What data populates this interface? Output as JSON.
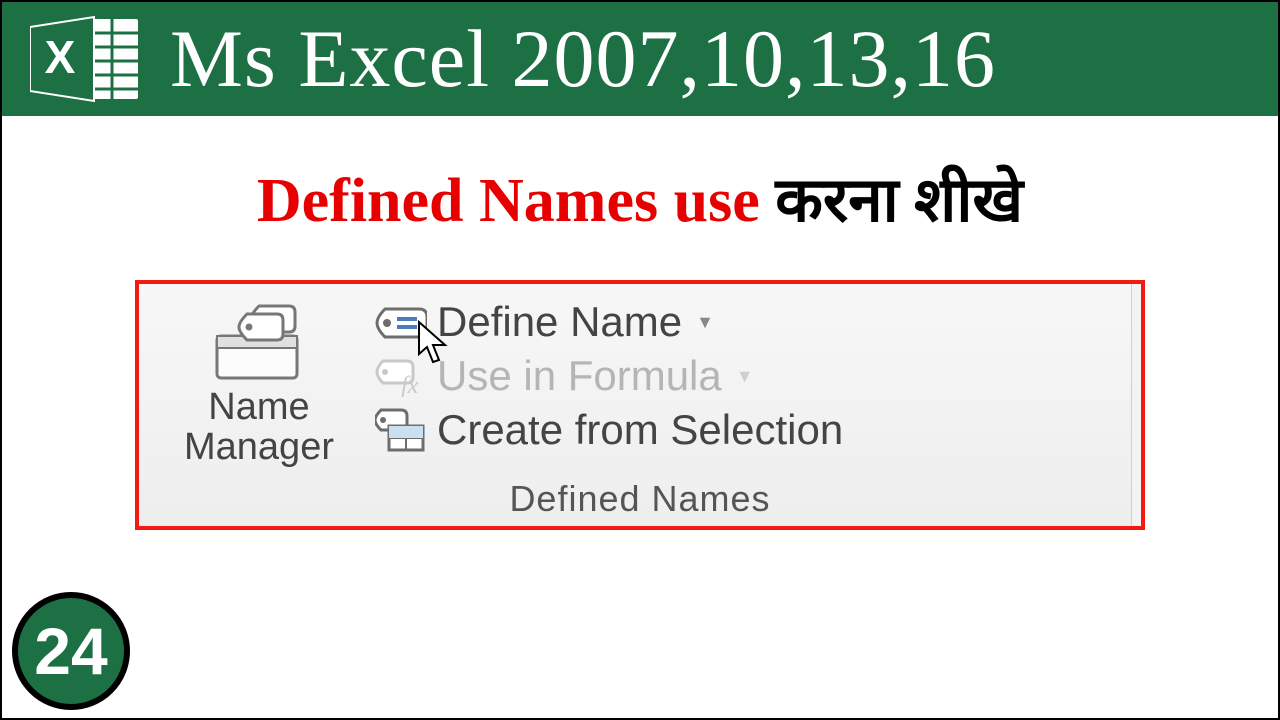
{
  "banner": {
    "title": "Ms Excel 2007,10,13,16"
  },
  "subtitle": {
    "part1": "Defined Names use ",
    "part2": "करना शीखे"
  },
  "ribbon": {
    "name_manager": {
      "line1": "Name",
      "line2": "Manager"
    },
    "define_name": "Define Name",
    "use_in_formula": "Use in Formula",
    "create_from_selection": "Create from Selection",
    "group_label": "Defined Names"
  },
  "badge": {
    "number": "24"
  }
}
